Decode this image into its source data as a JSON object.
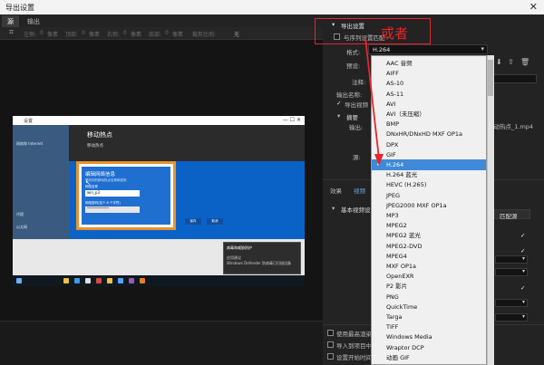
{
  "window": {
    "title": "导出设置",
    "close_glyph": "✕"
  },
  "left_tabs": [
    {
      "label": "源",
      "active": true
    },
    {
      "label": "输出",
      "active": false
    }
  ],
  "crop_bar": {
    "items": [
      "左侧:",
      "0",
      "像素",
      "顶部:",
      "0",
      "像素",
      "右侧:",
      "0",
      "像素",
      "底部:",
      "0",
      "像素",
      "裁剪比例:"
    ],
    "value": "无"
  },
  "inner_screen": {
    "titlebar": "设置",
    "page_title": "移动热点",
    "page_subtitle": "移动热点",
    "dialog": {
      "title": "编辑网络信息",
      "desc": "更改你的移动热点名称和密码",
      "name_label": "网络名称",
      "name_value": "win_p3",
      "pw_label": "网络密码(至少 8 个字符)",
      "pw_value": "************",
      "save": "保存",
      "cancel": "取消"
    },
    "notification": {
      "title": "病毒和威胁防护",
      "line1": "应用建议",
      "line2": "Windows Defender 防病毒已扫描设备"
    },
    "side_items": [
      "网络和 Internet",
      "状态",
      "以太网",
      "代理"
    ]
  },
  "export": {
    "section_title": "导出设置",
    "match_sequence_label": "与序列设置匹配",
    "format_label": "格式:",
    "format_value": "H.264",
    "preset_label": "预设:",
    "comment_label": "注释:",
    "output_name_label": "输出名称:",
    "export_video_label": "导出视频",
    "summary_label": "摘要",
    "output_label": "输出:",
    "output_path": "移动热点_1.mp4",
    "source_label": "源:",
    "tabs": [
      "效果",
      "视频"
    ],
    "basic_video_label": "基本视频设置",
    "match_source_button": "匹配源",
    "bottom_checks": [
      "使用最高渲染质量",
      "导入到项目中",
      "设置开始时间码"
    ],
    "icon_names": [
      "save-preset-icon",
      "import-preset-icon",
      "delete-preset-icon"
    ]
  },
  "annotation": {
    "text": "或者",
    "color": "#e5262b"
  },
  "format_options": [
    "AAC 音频",
    "AIFF",
    "AS-10",
    "AS-11",
    "AVI",
    "AVI（未压缩）",
    "BMP",
    "DNxHR/DNxHD MXF OP1a",
    "DPX",
    "GIF",
    "H.264",
    "H.264 蓝光",
    "HEVC (H.265)",
    "JPEG",
    "JPEG2000 MXF OP1a",
    "MP3",
    "MPEG2",
    "MPEG2 蓝光",
    "MPEG2-DVD",
    "MPEG4",
    "MXF OP1a",
    "OpenEXR",
    "P2 影片",
    "PNG",
    "QuickTime",
    "Targa",
    "TIFF",
    "Windows Media",
    "Wraptor DCP",
    "动画 GIF"
  ],
  "format_selected": "H.264",
  "colors": {
    "accent_selection": "#3f8ad8",
    "highlight_border": "#e9932b",
    "panel": "#232323"
  }
}
